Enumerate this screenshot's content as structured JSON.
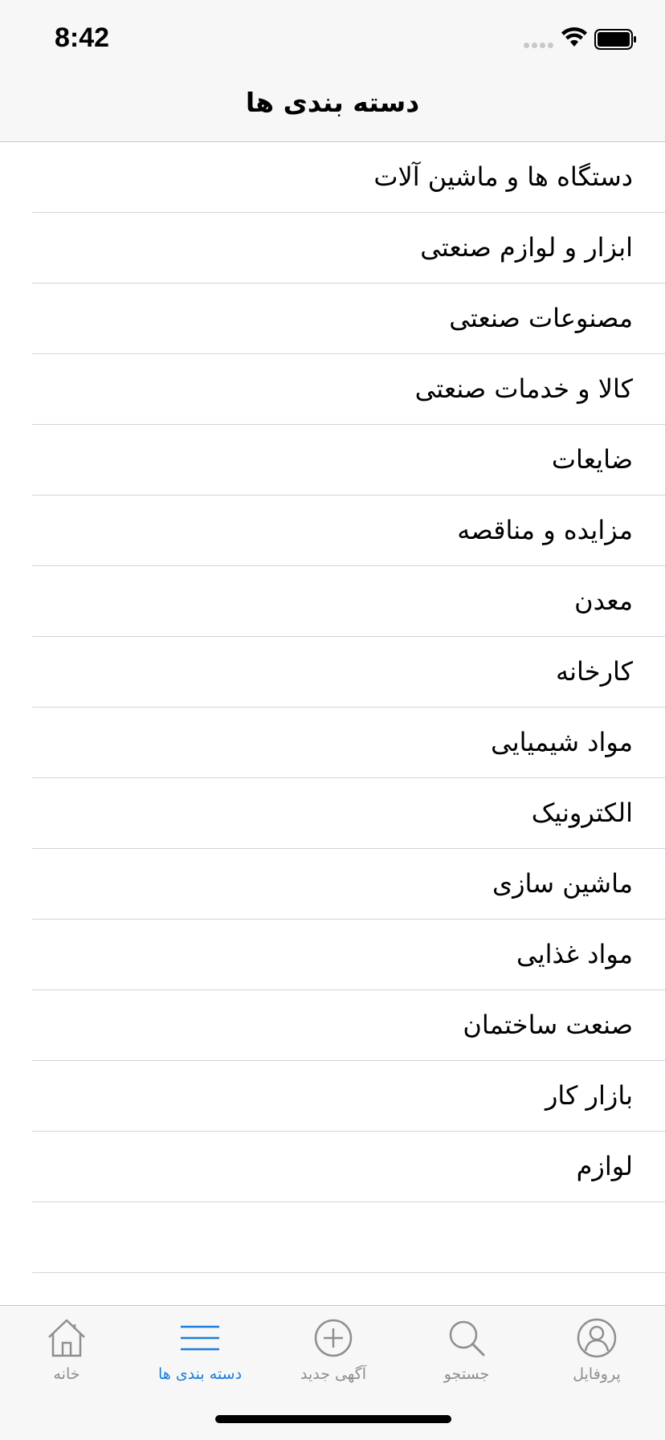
{
  "status": {
    "time": "8:42"
  },
  "nav": {
    "title": "دسته بندی ها"
  },
  "categories": [
    "دستگاه ها و ماشین آلات",
    "ابزار و لوازم صنعتی",
    "مصنوعات صنعتی",
    "کالا و خدمات صنعتی",
    "ضایعات",
    "مزایده و مناقصه",
    "معدن",
    "کارخانه",
    "مواد شیمیایی",
    "الکترونیک",
    "ماشین سازی",
    "مواد غذایی",
    "صنعت ساختمان",
    "بازار کار",
    "لوازم",
    ""
  ],
  "tabs": [
    {
      "label": "خانه",
      "icon": "home-icon",
      "active": false
    },
    {
      "label": "دسته بندی ها",
      "icon": "menu-icon",
      "active": true
    },
    {
      "label": "آگهی جدید",
      "icon": "plus-circle-icon",
      "active": false
    },
    {
      "label": "جستجو",
      "icon": "search-icon",
      "active": false
    },
    {
      "label": "پروفایل",
      "icon": "profile-icon",
      "active": false
    }
  ],
  "colors": {
    "accent": "#1a7de0",
    "inactive": "#8e8e93"
  }
}
